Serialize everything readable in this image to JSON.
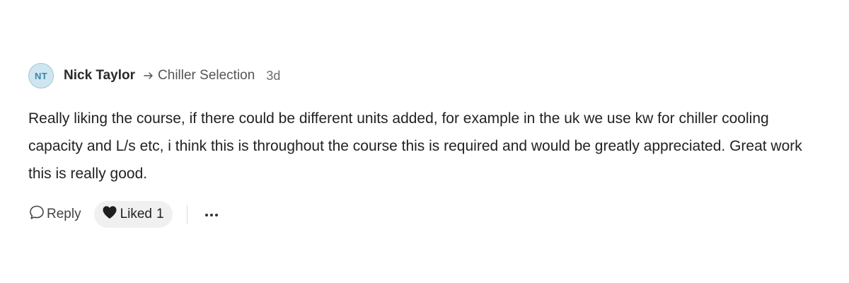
{
  "comment": {
    "avatar_initials": "NT",
    "author": "Nick Taylor",
    "topic": "Chiller Selection",
    "time": "3d",
    "body": "Really liking the course, if there could be different units added, for example in the uk we use kw for chiller cooling capacity and L/s etc, i think this is throughout the course this is required and would be greatly appreciated. Great work this is really good."
  },
  "actions": {
    "reply_label": "Reply",
    "liked_label": "Liked",
    "liked_count": "1",
    "more_icon": "more-horizontal-icon",
    "reply_icon": "speech-bubble-icon",
    "like_icon": "heart-icon"
  },
  "colors": {
    "avatar_bg": "#cfe6f0",
    "avatar_text": "#3a86a8",
    "liked_bg": "#f0f0f0"
  }
}
